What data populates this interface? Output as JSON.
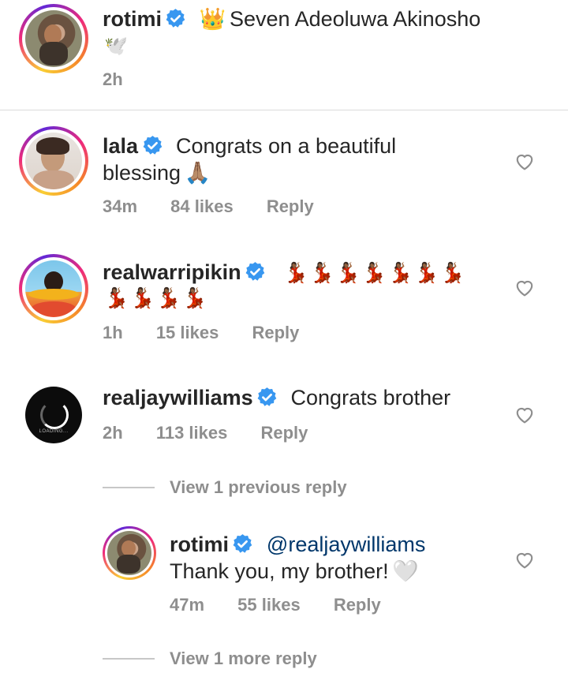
{
  "caption": {
    "username": "rotimi",
    "crown_emoji": "👑",
    "text": "Seven Adeoluwa Akinosho",
    "dove_emoji": "🕊️",
    "time": "2h"
  },
  "comments": [
    {
      "username": "lala",
      "text_line1": "Congrats on a beautiful",
      "text_line2": "blessing",
      "emoji": "🙏🏽",
      "time": "34m",
      "likes": "84 likes",
      "reply_label": "Reply"
    },
    {
      "username": "realwarripikin",
      "emoji_line1": "💃🏾💃🏾💃🏾💃🏾💃🏾💃🏾💃🏾",
      "emoji_line2": "💃🏾💃🏾💃🏾💃🏾",
      "time": "1h",
      "likes": "15 likes",
      "reply_label": "Reply"
    },
    {
      "username": "realjaywilliams",
      "text": "Congrats brother",
      "avatar_text": "LOADING...",
      "time": "2h",
      "likes": "113 likes",
      "reply_label": "Reply"
    }
  ],
  "view_previous": "View 1 previous reply",
  "reply": {
    "username": "rotimi",
    "mention": "@realjaywilliams",
    "text": "Thank you, my brother!",
    "emoji": "🤍",
    "time": "47m",
    "likes": "55 likes",
    "reply_label": "Reply"
  },
  "view_more": "View 1 more reply",
  "colors": {
    "verified": "#3897f0",
    "meta": "#8e8e8e",
    "mention": "#00376b"
  }
}
